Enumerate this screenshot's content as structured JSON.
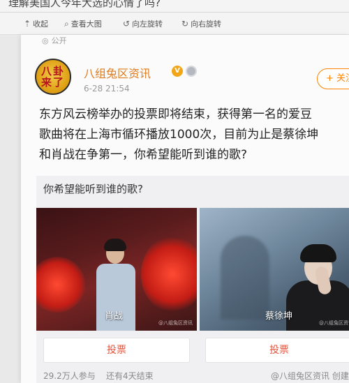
{
  "top_caption": "理解美国人今年大选的心情了吗?",
  "toolbar": {
    "items": [
      {
        "icon": "collapse-icon",
        "glyph": "⇡",
        "label": "收起"
      },
      {
        "icon": "zoom-icon",
        "glyph": "⌕",
        "label": "查看大图"
      },
      {
        "icon": "rotate-left-icon",
        "glyph": "↺",
        "label": "向左旋转"
      },
      {
        "icon": "rotate-right-icon",
        "glyph": "↻",
        "label": "向右旋转"
      }
    ]
  },
  "post": {
    "visibility": "公开",
    "author": "八组兔区资讯",
    "avatar_text_1": "八卦",
    "avatar_text_2": "来了",
    "verified_badge": "V",
    "time": "6-28 21:54",
    "follow_label": "+ 关注",
    "body_lines": [
      "东方风云榜举办的投票即将结束，获得第一名的爱豆",
      "歌曲将在上海市循环播放1000次，目前为止是蔡徐坤",
      "和肖战在争第一，你希望能听到谁的歌?"
    ]
  },
  "poll": {
    "question": "你希望能听到谁的歌?",
    "options": [
      {
        "name": "肖战",
        "vote_label": "投票",
        "watermark": "@八组兔区资讯"
      },
      {
        "name": "蔡徐坤",
        "vote_label": "投票",
        "watermark": "@八组兔区资讯"
      }
    ],
    "participants": "29.2万人参与",
    "remaining": "还有4天结束",
    "source": "@八组兔区资讯 创建"
  },
  "colors": {
    "accent_orange": "#ff8200",
    "username": "#e07c1f",
    "vote_text": "#e8533b"
  }
}
